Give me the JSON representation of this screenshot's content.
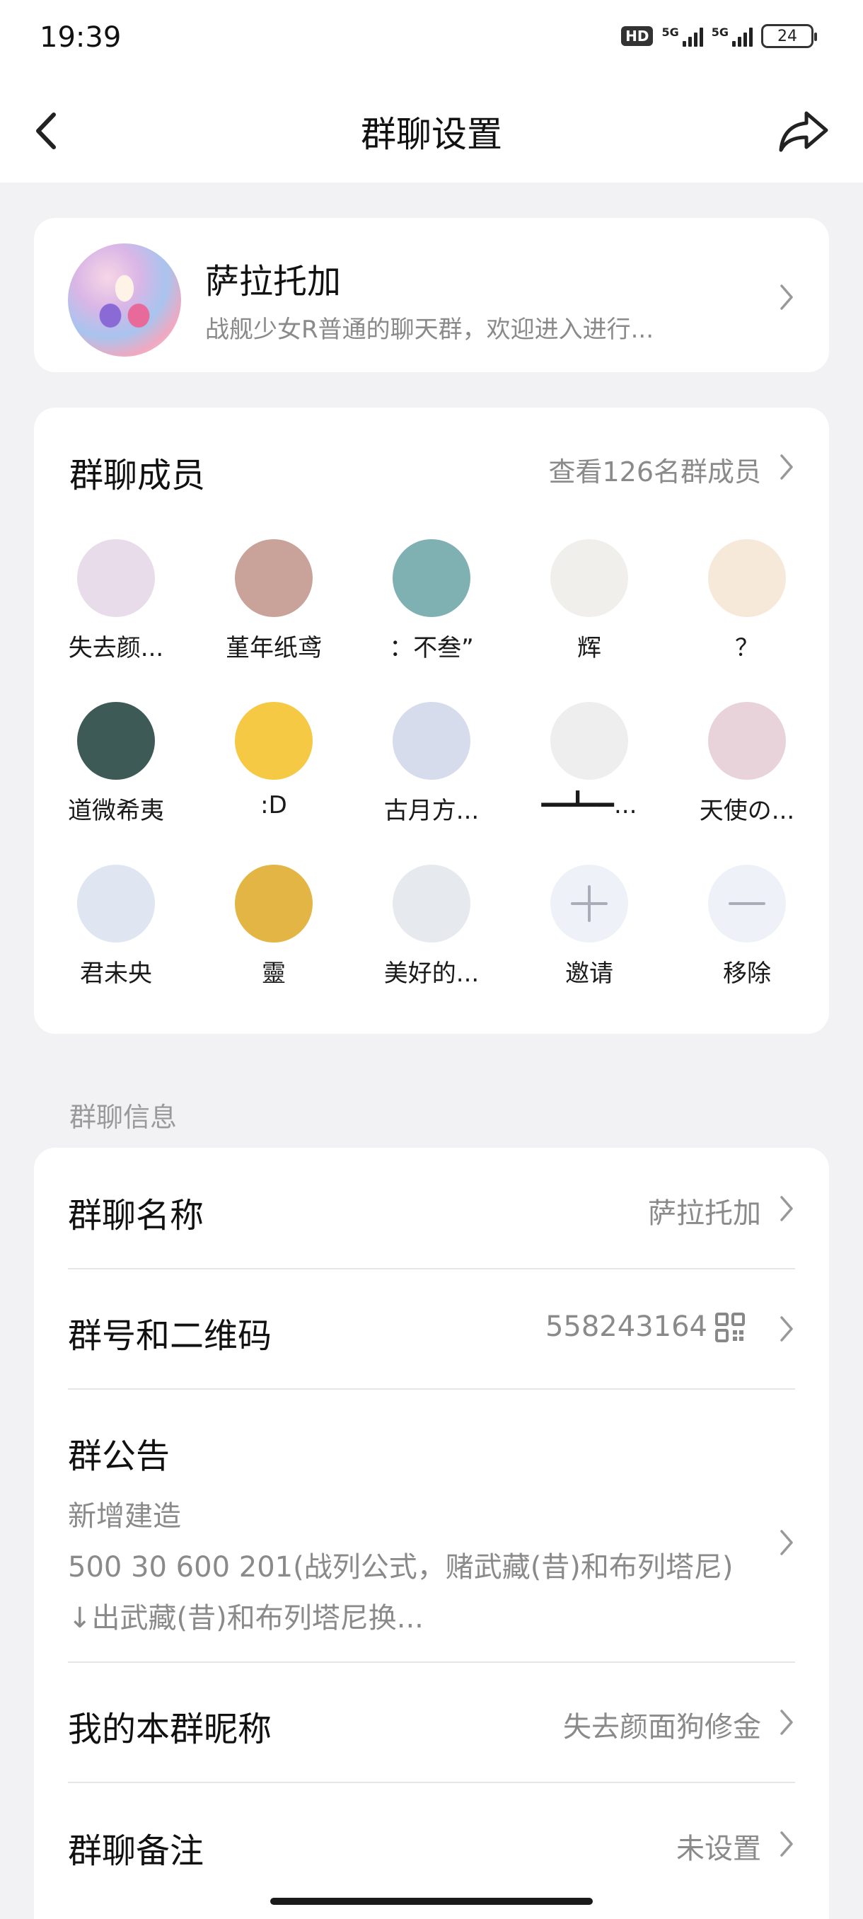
{
  "status_bar": {
    "time": "19:39",
    "hd_badge": "HD",
    "signal1_label": "5G",
    "signal2_label": "5G",
    "battery": "24"
  },
  "nav": {
    "title": "群聊设置",
    "back_icon": "back-arrow-icon",
    "share_icon": "share-icon"
  },
  "group": {
    "name": "萨拉托加",
    "description": "战舰少女R普通的聊天群，欢迎进入进行..."
  },
  "members": {
    "title": "群聊成员",
    "view_all": "查看126名群成员",
    "list": [
      {
        "name": "失去颜...",
        "color": "#e8dcea"
      },
      {
        "name": "堇年纸鸢",
        "color": "#c9a39a"
      },
      {
        "name": "：不叁”",
        "color": "#7fb0b2"
      },
      {
        "name": "辉",
        "color": "#f1efec"
      },
      {
        "name": "？",
        "color": "#f6e9da"
      },
      {
        "name": "道微希夷",
        "color": "#3d5a57"
      },
      {
        "name": ":D",
        "color": "#f6c944"
      },
      {
        "name": "古月方...",
        "color": "#d6dcec"
      },
      {
        "name": "━━┻━━...",
        "color": "#eeeeee"
      },
      {
        "name": "天使の...",
        "color": "#e9d3da"
      },
      {
        "name": "君未央",
        "color": "#dfe6f2"
      },
      {
        "name": "靈",
        "color": "#e3b544"
      },
      {
        "name": "美好的...",
        "color": "#e6e9ee"
      }
    ],
    "invite_label": "邀请",
    "remove_label": "移除"
  },
  "info_section": {
    "label": "群聊信息",
    "group_name_label": "群聊名称",
    "group_name_value": "萨拉托加",
    "group_id_label": "群号和二维码",
    "group_id_value": "558243164",
    "qr_icon": "qr-code-icon",
    "notice_label": "群公告",
    "notice_line1": "新增建造",
    "notice_line2": "500 30 600 201(战列公式，赌武藏(昔)和布列塔尼)",
    "notice_line3": "↓出武藏(昔)和布列塔尼换...",
    "nickname_label": "我的本群昵称",
    "nickname_value": "失去颜面狗修金",
    "remark_label": "群聊备注",
    "remark_value": "未设置"
  }
}
